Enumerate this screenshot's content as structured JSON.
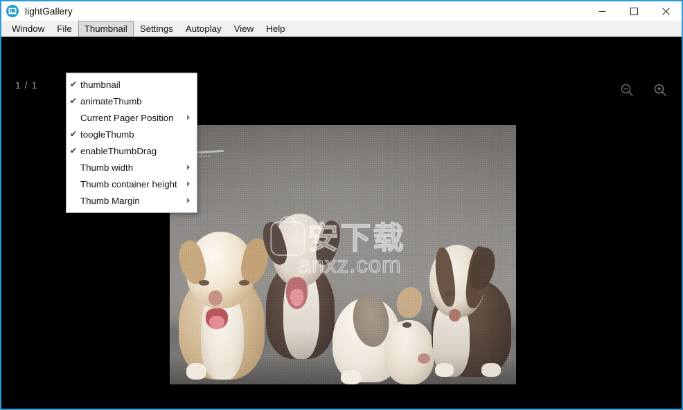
{
  "window": {
    "title": "lightGallery",
    "app_icon": "gallery-icon",
    "accent_color": "#2a9ada",
    "controls": [
      {
        "name": "minimize",
        "glyph": "minimize-icon"
      },
      {
        "name": "maximize",
        "glyph": "maximize-icon"
      },
      {
        "name": "close",
        "glyph": "close-icon"
      }
    ]
  },
  "menubar": {
    "items": [
      {
        "label": "Window",
        "active": false
      },
      {
        "label": "File",
        "active": false
      },
      {
        "label": "Thumbnail",
        "active": true
      },
      {
        "label": "Settings",
        "active": false
      },
      {
        "label": "Autoplay",
        "active": false
      },
      {
        "label": "View",
        "active": false
      },
      {
        "label": "Help",
        "active": false
      }
    ]
  },
  "dropdown": {
    "owner": "Thumbnail",
    "items": [
      {
        "label": "thumbnail",
        "checked": true,
        "submenu": false
      },
      {
        "label": "animateThumb",
        "checked": true,
        "submenu": false
      },
      {
        "label": "Current Pager Position",
        "checked": false,
        "submenu": true
      },
      {
        "label": "toogleThumb",
        "checked": true,
        "submenu": false
      },
      {
        "label": "enableThumbDrag",
        "checked": true,
        "submenu": false
      },
      {
        "label": "Thumb width",
        "checked": false,
        "submenu": true
      },
      {
        "label": "Thumb container height",
        "checked": false,
        "submenu": true
      },
      {
        "label": "Thumb Margin",
        "checked": false,
        "submenu": true
      }
    ],
    "check_glyph": "✔"
  },
  "viewer": {
    "background_color": "#000000",
    "pager_count": "1 / 1",
    "zoom_out": {
      "name": "zoom-out-icon",
      "label": "Zoom out"
    },
    "zoom_in": {
      "name": "zoom-in-icon",
      "label": "Zoom in"
    },
    "photo": {
      "alt": "four puppies sitting on a gray concrete floor",
      "corner_watermark": "photo",
      "watermark_cjk": "安下载",
      "watermark_url": "anxz.com"
    }
  }
}
